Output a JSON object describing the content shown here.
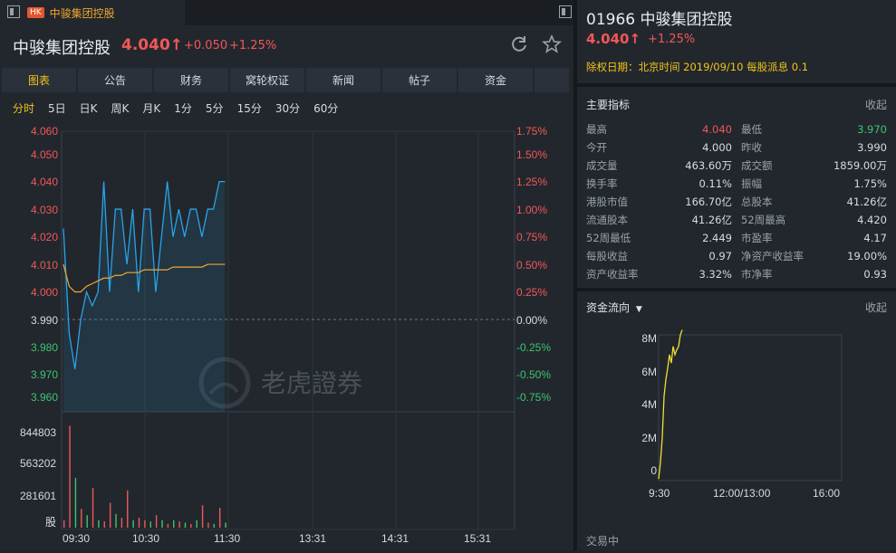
{
  "tab": {
    "badge": "HK",
    "title": "中骏集团控股"
  },
  "header": {
    "name": "中骏集团控股",
    "price": "4.040↑",
    "change": "+0.050",
    "change_pct": "+1.25%"
  },
  "menu": [
    "图表",
    "公告",
    "财务",
    "窝轮权证",
    "新闻",
    "帖子",
    "资金"
  ],
  "periods": [
    "分时",
    "5日",
    "日K",
    "周K",
    "月K",
    "1分",
    "5分",
    "15分",
    "30分",
    "60分"
  ],
  "chart": {
    "price_ticks": [
      "4.060",
      "4.050",
      "4.040",
      "4.030",
      "4.020",
      "4.010",
      "4.000",
      "3.990",
      "3.980",
      "3.970",
      "3.960"
    ],
    "pct_ticks": [
      "1.75%",
      "1.50%",
      "1.25%",
      "1.00%",
      "0.75%",
      "0.50%",
      "0.25%",
      "0.00%",
      "-0.25%",
      "-0.50%",
      "-0.75%"
    ],
    "vol_ticks": [
      "844803",
      "563202",
      "281601",
      "股"
    ],
    "time_ticks": [
      "09:30",
      "10:30",
      "11:30",
      "13:31",
      "14:31",
      "15:31"
    ],
    "watermark": "老虎證券",
    "price_series": [
      4.023,
      3.985,
      3.972,
      3.99,
      4.0,
      3.995,
      4.0,
      4.04,
      4.0,
      4.03,
      4.03,
      4.01,
      4.03,
      4.0,
      4.03,
      4.03,
      4.0,
      4.02,
      4.04,
      4.02,
      4.03,
      4.02,
      4.03,
      4.03,
      4.02,
      4.03,
      4.03,
      4.04,
      4.04
    ],
    "avg_series": [
      4.01,
      4.002,
      4.0,
      4.0,
      4.002,
      4.003,
      4.004,
      4.005,
      4.005,
      4.006,
      4.006,
      4.007,
      4.007,
      4.007,
      4.008,
      4.008,
      4.008,
      4.008,
      4.008,
      4.009,
      4.009,
      4.009,
      4.009,
      4.009,
      4.009,
      4.01,
      4.01,
      4.01,
      4.01
    ],
    "volumes": [
      60000,
      820000,
      400000,
      150000,
      100000,
      320000,
      60000,
      50000,
      200000,
      110000,
      80000,
      300000,
      60000,
      80000,
      60000,
      50000,
      100000,
      60000,
      30000,
      60000,
      50000,
      40000,
      30000,
      60000,
      180000,
      40000,
      30000,
      160000,
      40000
    ],
    "volume_colors": [
      "red",
      "red",
      "green",
      "red",
      "green",
      "red",
      "green",
      "red",
      "red",
      "green",
      "red",
      "red",
      "green",
      "red",
      "red",
      "green",
      "red",
      "green",
      "red",
      "green",
      "red",
      "green",
      "red",
      "green",
      "red",
      "red",
      "green",
      "red",
      "green"
    ]
  },
  "quote": {
    "code_name": "01966 中骏集团控股",
    "price": "4.040↑",
    "change_pct": "+1.25%",
    "dividend_note": "除权日期：北京时间 2019/09/10 每股派息 0.1"
  },
  "indicators": {
    "header": "主要指标",
    "collapse": "收起",
    "rows": [
      {
        "l1": "最高",
        "v1": "4.040",
        "c1": "up",
        "l2": "最低",
        "v2": "3.970",
        "c2": "down"
      },
      {
        "l1": "今开",
        "v1": "4.000",
        "c1": "",
        "l2": "昨收",
        "v2": "3.990",
        "c2": ""
      },
      {
        "l1": "成交量",
        "v1": "463.60万",
        "c1": "",
        "l2": "成交额",
        "v2": "1859.00万",
        "c2": ""
      },
      {
        "l1": "换手率",
        "v1": "0.11%",
        "c1": "",
        "l2": "振幅",
        "v2": "1.75%",
        "c2": ""
      },
      {
        "l1": "港股市值",
        "v1": "166.70亿",
        "c1": "",
        "l2": "总股本",
        "v2": "41.26亿",
        "c2": ""
      },
      {
        "l1": "流通股本",
        "v1": "41.26亿",
        "c1": "",
        "l2": "52周最高",
        "v2": "4.420",
        "c2": ""
      },
      {
        "l1": "52周最低",
        "v1": "2.449",
        "c1": "",
        "l2": "市盈率",
        "v2": "4.17",
        "c2": ""
      },
      {
        "l1": "每股收益",
        "v1": "0.97",
        "c1": "",
        "l2": "净资产收益率",
        "v2": "19.00%",
        "c2": ""
      },
      {
        "l1": "资产收益率",
        "v1": "3.32%",
        "c1": "",
        "l2": "市净率",
        "v2": "0.93",
        "c2": ""
      }
    ]
  },
  "capital_flow": {
    "header": "资金流向",
    "collapse": "收起",
    "y_ticks": [
      "8M",
      "6M",
      "4M",
      "2M",
      "0"
    ],
    "x_ticks": [
      "9:30",
      "12:00/13:00",
      "16:00"
    ],
    "series": [
      -0.5,
      0.5,
      2.0,
      4.5,
      5.5,
      6.2,
      7.0,
      6.5,
      7.5,
      7.0,
      7.3,
      7.5,
      8.2,
      8.5
    ]
  },
  "status": "交易中",
  "colors": {
    "up": "#f25757",
    "down": "#3ec46d",
    "accent": "#f0c419",
    "price_line": "#29a3e6",
    "avg_line": "#f0a630"
  }
}
